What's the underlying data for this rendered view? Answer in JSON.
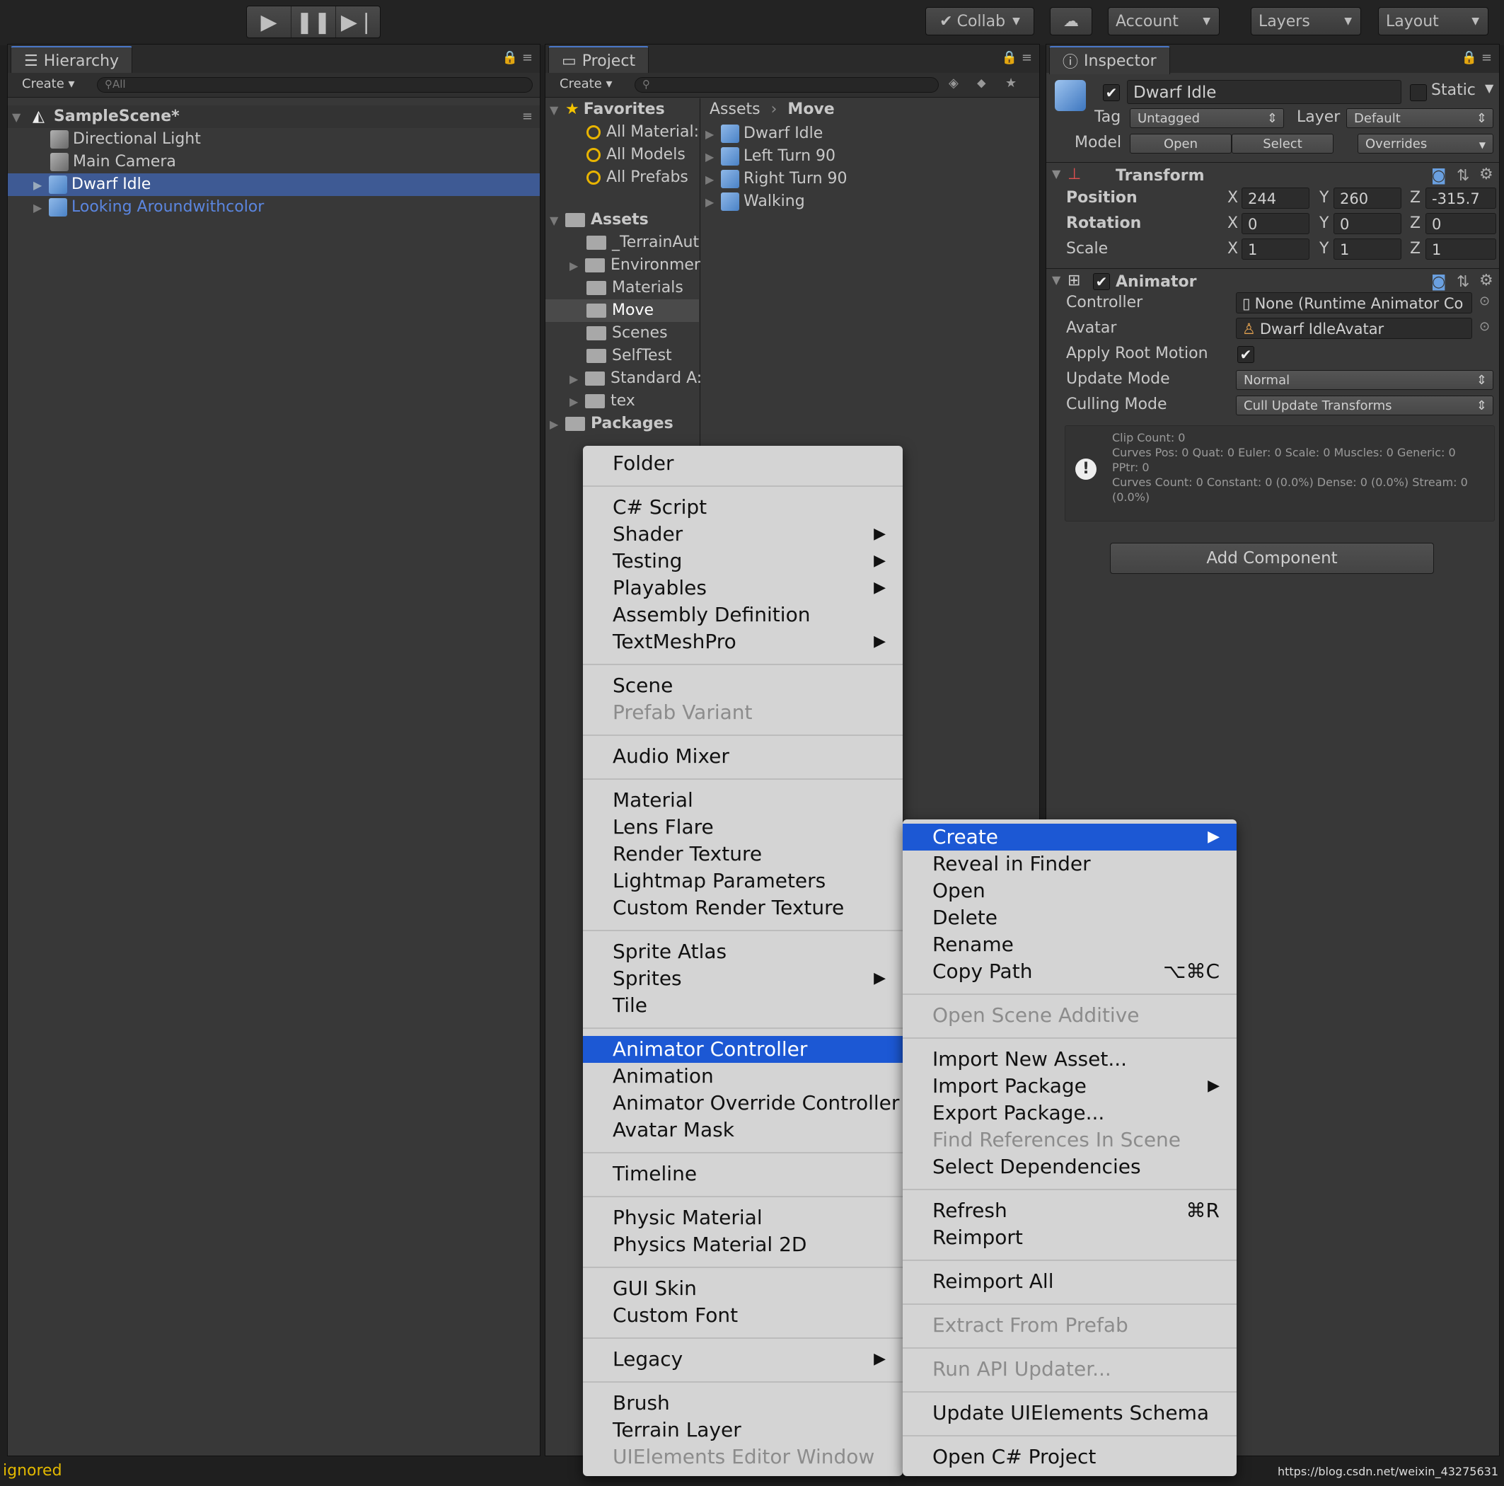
{
  "toolbar": {
    "collab": "Collab",
    "account": "Account",
    "layers": "Layers",
    "layout": "Layout"
  },
  "hierarchy": {
    "tab": "Hierarchy",
    "create": "Create",
    "search_placeholder": "All",
    "scene": "SampleScene*",
    "items": [
      "Directional Light",
      "Main Camera",
      "Dwarf Idle",
      "Looking Aroundwithcolor"
    ]
  },
  "project": {
    "tab": "Project",
    "create": "Create",
    "favorites": "Favorites",
    "fav_items": [
      "All Material:",
      "All Models",
      "All Prefabs"
    ],
    "assets": "Assets",
    "asset_folders": [
      "_TerrainAut",
      "Environmer",
      "Materials",
      "Move",
      "Scenes",
      "SelfTest",
      "Standard A:",
      "tex"
    ],
    "packages": "Packages",
    "breadcrumb_root": "Assets",
    "breadcrumb_current": "Move",
    "files": [
      "Dwarf Idle",
      "Left Turn 90",
      "Right Turn 90",
      "Walking"
    ]
  },
  "inspector": {
    "tab": "Inspector",
    "object_name": "Dwarf Idle",
    "static": "Static",
    "tag_label": "Tag",
    "tag_value": "Untagged",
    "layer_label": "Layer",
    "layer_value": "Default",
    "model_label": "Model",
    "open": "Open",
    "select": "Select",
    "overrides": "Overrides",
    "transform": {
      "title": "Transform",
      "position": "Position",
      "rotation": "Rotation",
      "scale": "Scale",
      "x": "X",
      "y": "Y",
      "z": "Z",
      "pos": [
        "244",
        "260",
        "-315.7"
      ],
      "rot": [
        "0",
        "0",
        "0"
      ],
      "scl": [
        "1",
        "1",
        "1"
      ]
    },
    "animator": {
      "title": "Animator",
      "controller_label": "Controller",
      "controller_value": "None (Runtime Animator Co",
      "avatar_label": "Avatar",
      "avatar_value": "Dwarf IdleAvatar",
      "apply_root_label": "Apply Root Motion",
      "update_label": "Update Mode",
      "update_value": "Normal",
      "culling_label": "Culling Mode",
      "culling_value": "Cull Update Transforms",
      "info": [
        "Clip Count: 0",
        "Curves Pos: 0 Quat: 0 Euler: 0 Scale: 0 Muscles: 0 Generic: 0",
        "PPtr: 0",
        "Curves Count: 0 Constant: 0 (0.0%) Dense: 0 (0.0%) Stream: 0",
        "(0.0%)"
      ]
    },
    "add_component": "Add Component"
  },
  "create_menu": {
    "items": [
      "Folder",
      "C# Script",
      "Shader",
      "Testing",
      "Playables",
      "Assembly Definition",
      "TextMeshPro",
      "Scene",
      "Prefab Variant",
      "Audio Mixer",
      "Material",
      "Lens Flare",
      "Render Texture",
      "Lightmap Parameters",
      "Custom Render Texture",
      "Sprite Atlas",
      "Sprites",
      "Tile",
      "Animator Controller",
      "Animation",
      "Animator Override Controller",
      "Avatar Mask",
      "Timeline",
      "Physic Material",
      "Physics Material 2D",
      "GUI Skin",
      "Custom Font",
      "Legacy",
      "Brush",
      "Terrain Layer",
      "UIElements Editor Window"
    ]
  },
  "context_menu": {
    "items": [
      "Create",
      "Reveal in Finder",
      "Open",
      "Delete",
      "Rename",
      "Copy Path",
      "Open Scene Additive",
      "Import New Asset...",
      "Import Package",
      "Export Package...",
      "Find References In Scene",
      "Select Dependencies",
      "Refresh",
      "Reimport",
      "Reimport All",
      "Extract From Prefab",
      "Run API Updater...",
      "Update UIElements Schema",
      "Open C# Project"
    ],
    "shortcuts": {
      "copy_path": "⌥⌘C",
      "refresh": "⌘R"
    }
  },
  "status": {
    "left": "ignored",
    "right": "https://blog.csdn.net/weixin_43275631"
  }
}
